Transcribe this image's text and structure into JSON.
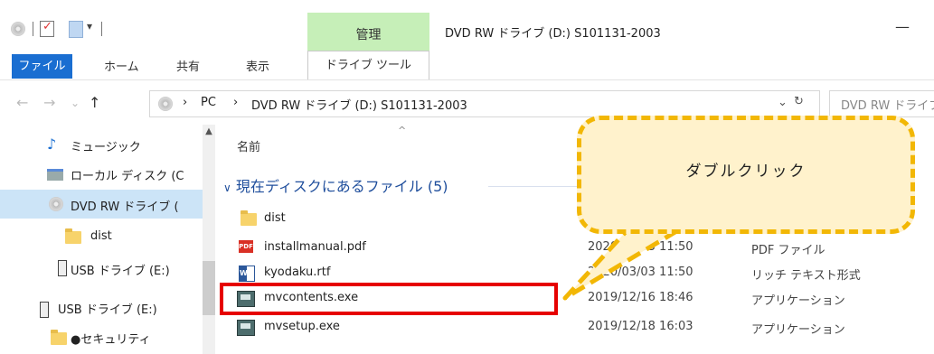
{
  "window": {
    "title": "DVD RW ドライブ (D:) S101131-2003",
    "context_group": "管理",
    "minimize_glyph": "—"
  },
  "ribbon": {
    "tabs": [
      "ファイル",
      "ホーム",
      "共有",
      "表示",
      "ドライブ ツール"
    ]
  },
  "address": {
    "crumbs": [
      "PC",
      "DVD RW ドライブ (D:) S101131-2003"
    ],
    "separator": "›",
    "search_placeholder": "DVD RW ドライブ"
  },
  "navpane": {
    "items": [
      {
        "label": "ミュージック",
        "icon": "music-note-icon"
      },
      {
        "label": "ローカル ディスク (C",
        "icon": "local-disk-icon"
      },
      {
        "label": "DVD RW ドライブ (",
        "icon": "dvd-drive-icon",
        "selected": true
      },
      {
        "label": "dist",
        "icon": "folder-icon"
      },
      {
        "label": "USB ドライブ (E:)",
        "icon": "usb-drive-icon"
      },
      {
        "label": "USB ドライブ (E:)",
        "icon": "usb-drive-icon"
      },
      {
        "label": "●セキュリティ",
        "icon": "folder-icon"
      }
    ]
  },
  "filelist": {
    "column_name": "名前",
    "group_header": "現在ディスクにあるファイル (5)",
    "files": [
      {
        "name": "dist",
        "date": "",
        "type": "",
        "icon": "folder-icon"
      },
      {
        "name": "installmanual.pdf",
        "date": "2020/03/03 11:50",
        "type": "PDF ファイル",
        "icon": "pdf-icon"
      },
      {
        "name": "kyodaku.rtf",
        "date": "2020/03/03 11:50",
        "type": "リッチ テキスト形式",
        "icon": "rtf-icon"
      },
      {
        "name": "mvcontents.exe",
        "date": "2019/12/16 18:46",
        "type": "アプリケーション",
        "icon": "exe-icon"
      },
      {
        "name": "mvsetup.exe",
        "date": "2019/12/18 16:03",
        "type": "アプリケーション",
        "icon": "exe-icon"
      }
    ]
  },
  "callout": {
    "text": "ダブルクリック",
    "fill_color": "#fff2cc",
    "border_color": "#f2b705"
  },
  "highlight": {
    "target": "mvcontents.exe",
    "color": "#e60000"
  }
}
